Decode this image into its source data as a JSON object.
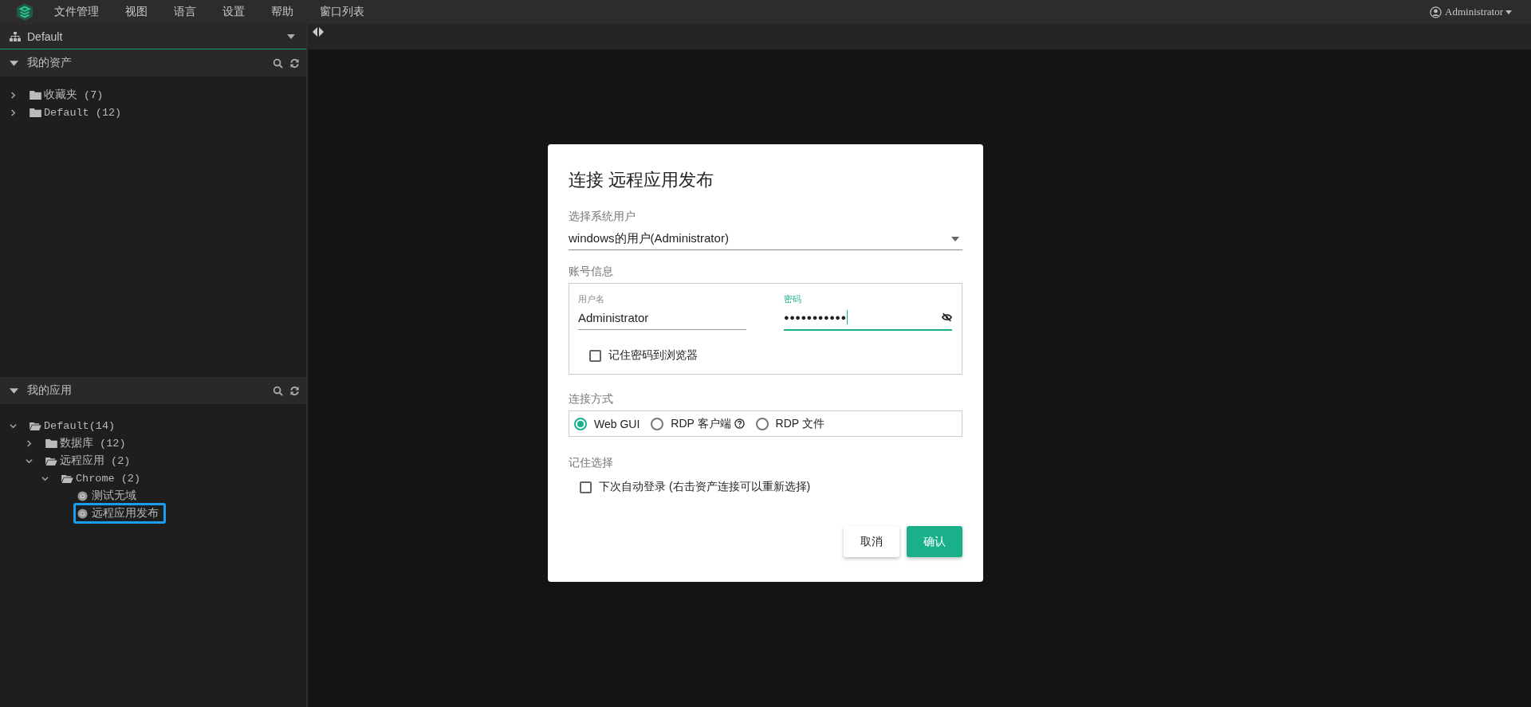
{
  "menu_bar": {
    "items": [
      "文件管理",
      "视图",
      "语言",
      "设置",
      "帮助",
      "窗口列表"
    ],
    "user": "Administrator"
  },
  "sidebar": {
    "project": "Default",
    "sections": [
      {
        "title": "我的资产",
        "tree": [
          {
            "label": "收藏夹 (7)",
            "kind": "folder",
            "expanded": false,
            "selected": false
          },
          {
            "label": "Default (12)",
            "kind": "folder",
            "expanded": false,
            "selected": false
          }
        ]
      },
      {
        "title": "我的应用",
        "tree": [
          {
            "label": "Default(14)",
            "kind": "folder",
            "expanded": true,
            "selected": false,
            "children": [
              {
                "label": "数据库 (12)",
                "kind": "folder",
                "expanded": false,
                "selected": false
              },
              {
                "label": "远程应用 (2)",
                "kind": "folder",
                "expanded": true,
                "selected": false,
                "children": [
                  {
                    "label": "Chrome (2)",
                    "kind": "folder",
                    "expanded": true,
                    "selected": false,
                    "children": [
                      {
                        "label": "测试无域",
                        "kind": "app",
                        "selected": false
                      },
                      {
                        "label": "远程应用发布",
                        "kind": "app",
                        "selected": true
                      }
                    ]
                  }
                ]
              }
            ]
          }
        ]
      }
    ]
  },
  "dialog": {
    "title": "连接 远程应用发布",
    "system_user": {
      "label": "选择系统用户",
      "value": "windows的用户(Administrator)"
    },
    "account": {
      "label": "账号信息",
      "fields": [
        {
          "label": "用户名",
          "value": "Administrator",
          "kind": "text",
          "focused": false
        },
        {
          "label": "密码",
          "value": "●●●●●●●●●●●",
          "kind": "password",
          "focused": true
        }
      ],
      "remember_password": {
        "label": "记住密码到浏览器",
        "checked": false
      }
    },
    "connect_method": {
      "label": "连接方式",
      "options": [
        {
          "label": "Web GUI",
          "selected": true,
          "help": false
        },
        {
          "label": "RDP 客户端",
          "selected": false,
          "help": true
        },
        {
          "label": "RDP 文件",
          "selected": false,
          "help": false
        }
      ]
    },
    "remember_choice": {
      "label": "记住选择",
      "option": {
        "label": "下次自动登录 (右击资产连接可以重新选择)",
        "checked": false
      }
    },
    "buttons": [
      {
        "label": "取消",
        "kind": "secondary"
      },
      {
        "label": "确认",
        "kind": "primary"
      }
    ]
  }
}
